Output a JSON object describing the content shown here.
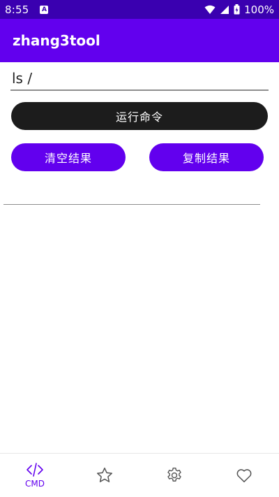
{
  "status_bar": {
    "time": "8:55",
    "battery": "100%",
    "icons": [
      "a-icon",
      "wifi-icon",
      "signal-icon",
      "battery-icon"
    ]
  },
  "app_bar": {
    "title": "zhang3tool"
  },
  "command": {
    "value": "ls /"
  },
  "buttons": {
    "run": "运行命令",
    "clear": "清空结果",
    "copy": "复制结果"
  },
  "result": {
    "text": ""
  },
  "bottom_nav": {
    "items": [
      {
        "icon": "code-icon",
        "label": "CMD",
        "active": true
      },
      {
        "icon": "star-icon",
        "label": "",
        "active": false
      },
      {
        "icon": "gear-icon",
        "label": "",
        "active": false
      },
      {
        "icon": "heart-icon",
        "label": "",
        "active": false
      }
    ]
  },
  "colors": {
    "status_bar": "#3a00b0",
    "primary": "#6200ee",
    "run_button": "#1c1c1c"
  }
}
